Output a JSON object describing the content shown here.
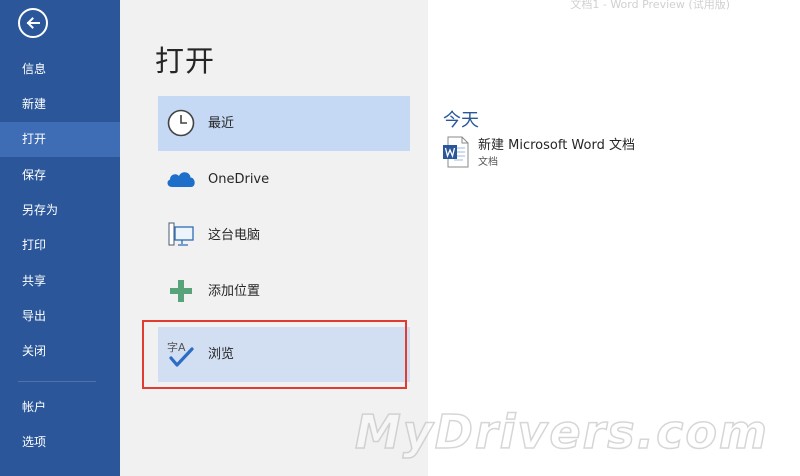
{
  "window": {
    "title": "文档1 - Word Preview (试用版)"
  },
  "sidebar": {
    "back_icon": "arrow-left-circle-icon",
    "items": [
      {
        "label": "信息"
      },
      {
        "label": "新建"
      },
      {
        "label": "打开"
      },
      {
        "label": "保存"
      },
      {
        "label": "另存为"
      },
      {
        "label": "打印"
      },
      {
        "label": "共享"
      },
      {
        "label": "导出"
      },
      {
        "label": "关闭"
      },
      {
        "label": "帐户"
      },
      {
        "label": "选项"
      }
    ],
    "active": "打开",
    "color": "#2b579a"
  },
  "main": {
    "title": "打开",
    "places": [
      {
        "label": "最近",
        "icon": "clock-icon"
      },
      {
        "label": "OneDrive",
        "icon": "cloud-icon"
      },
      {
        "label": "这台电脑",
        "icon": "computer-icon"
      },
      {
        "label": "添加位置",
        "icon": "plus-icon"
      },
      {
        "label": "浏览",
        "icon": "browse-icon",
        "icon_text": "字A"
      }
    ]
  },
  "recent": {
    "group_title": "今天",
    "files": [
      {
        "name": "新建 Microsoft Word 文档",
        "location": "文档",
        "icon": "word-document-icon"
      }
    ]
  },
  "watermark": "MyDrivers.com"
}
